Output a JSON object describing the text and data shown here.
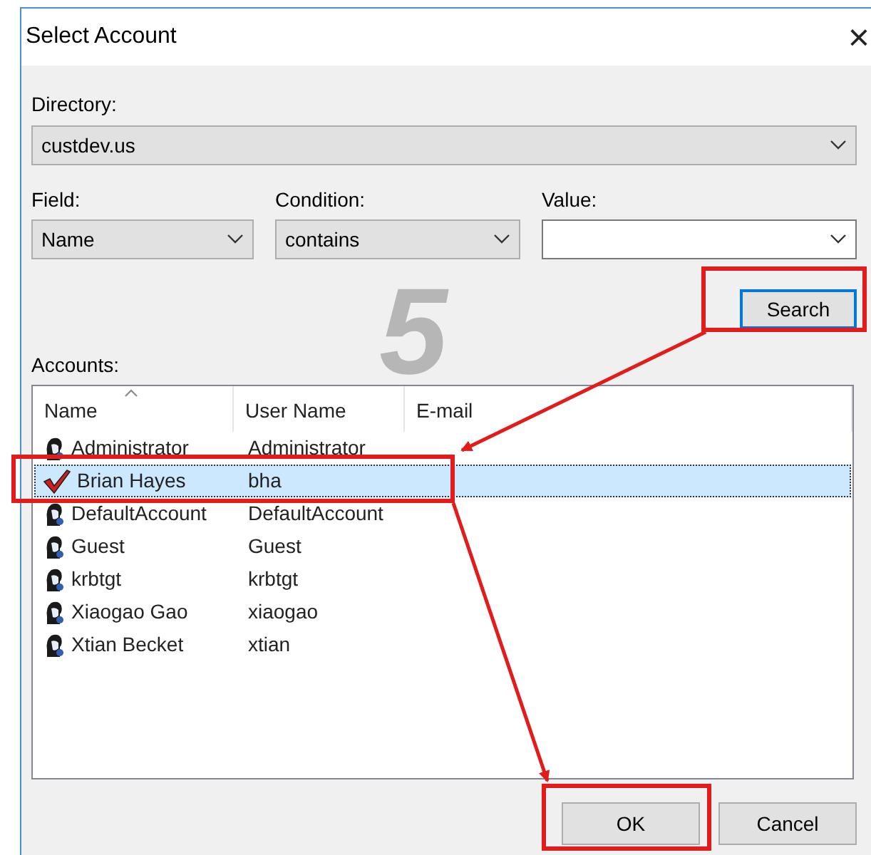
{
  "window": {
    "title": "Select Account",
    "close": "×"
  },
  "directory": {
    "label": "Directory:",
    "value": "custdev.us"
  },
  "filters": [
    {
      "label": "Field:",
      "value": "Name",
      "kind": "combo"
    },
    {
      "label": "Condition:",
      "value": "contains",
      "kind": "combo"
    },
    {
      "label": "Value:",
      "kind": "editable"
    }
  ],
  "search_button": "Search",
  "accounts": {
    "label": "Accounts:",
    "columns": [
      "Name",
      "User Name",
      "E-mail"
    ],
    "rows": [
      {
        "name": "Administrator",
        "user_name": "Administrator",
        "selected": false
      },
      {
        "name": "Brian Hayes",
        "user_name": "bha",
        "selected": true
      },
      {
        "name": "DefaultAccount",
        "user_name": "DefaultAccount",
        "selected": false
      },
      {
        "name": "Guest",
        "user_name": "Guest",
        "selected": false
      },
      {
        "name": "krbtgt",
        "user_name": "krbtgt",
        "selected": false
      },
      {
        "name": "Xiaogao Gao",
        "user_name": "xiaogao",
        "selected": false
      },
      {
        "name": "Xtian Becket",
        "user_name": "xtian",
        "selected": false
      }
    ]
  },
  "step_number": "5",
  "buttons": [
    "OK",
    "Cancel"
  ]
}
